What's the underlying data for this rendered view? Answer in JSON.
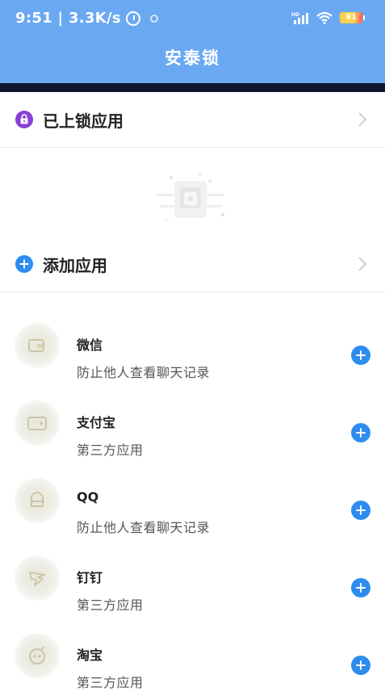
{
  "status_bar": {
    "time_speed": "9:51 | 3.3K/s",
    "network_label": "HD",
    "battery": "91"
  },
  "header": {
    "title": "安泰锁"
  },
  "locked_apps": {
    "label": "已上锁应用",
    "icon": "lock-icon"
  },
  "add_apps": {
    "label": "添加应用",
    "icon": "plus-circle-icon"
  },
  "colors": {
    "header": "#6aa8f2",
    "accent": "#2d8cf0",
    "lock_purple": "#8a3ed6"
  },
  "apps": [
    {
      "name": "微信",
      "desc": "防止他人查看聊天记录",
      "icon": "wechat-icon"
    },
    {
      "name": "支付宝",
      "desc": "第三方应用",
      "icon": "alipay-icon"
    },
    {
      "name": "QQ",
      "desc": "防止他人查看聊天记录",
      "icon": "qq-icon"
    },
    {
      "name": "钉钉",
      "desc": "第三方应用",
      "icon": "dingtalk-icon"
    },
    {
      "name": "淘宝",
      "desc": "第三方应用",
      "icon": "taobao-icon"
    }
  ]
}
